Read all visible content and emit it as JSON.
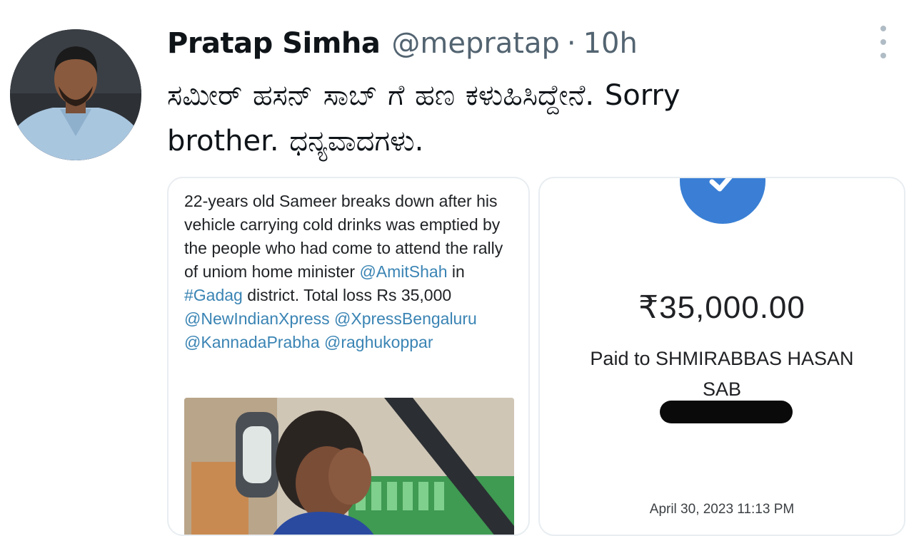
{
  "tweet": {
    "display_name": "Pratap Simha",
    "handle": "@mepratap",
    "separator": "·",
    "time_ago": "10h",
    "text_line1": "ಸಮೀರ್ ಹಸನ್ ಸಾಬ್ ಗೆ ಹಣ ಕಳುಹಿಸಿದ್ದೇನೆ. Sorry",
    "text_line2": "brother. ಧನ್ಯವಾದಗಳು.",
    "more_icon": "vertical-ellipsis-icon"
  },
  "news_card": {
    "text_1": "22-years old Sameer breaks down after his vehicle carrying cold drinks was emptied by the people who had come to attend the rally of uniom home minister",
    "mention_amitshah": "@AmitShah",
    "text_in": " in ",
    "hashtag_gadag": "#Gadag",
    "text_2": " district. Total loss Rs 35,000",
    "mention_newindianxpress": "@NewIndianXpress",
    "mention_xpressbengaluru": "@XpressBengaluru",
    "mention_kannadaprabha": "@KannadaPrabha",
    "mention_raghukoppar": "@raghukoppar"
  },
  "payment_card": {
    "status_icon": "check-icon",
    "amount": "₹35,000.00",
    "paid_to": "Paid to SHMIRABBAS HASAN SAB",
    "date": "April 30, 2023 11:13 PM"
  },
  "colors": {
    "link": "#3a84b4",
    "check_circle": "#3a7fd5",
    "muted_text": "#536471"
  }
}
